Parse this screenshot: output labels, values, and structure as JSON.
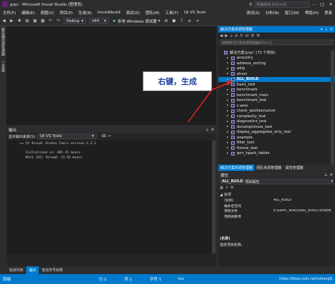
{
  "window": {
    "title": "grpc - Microsoft Visual Studio (管理员)",
    "quick_launch_placeholder": "快速启动 (Ctrl+Q)"
  },
  "menu": [
    "文件(F)",
    "编辑(E)",
    "视图(V)",
    "项目(P)",
    "生成(B)",
    "Incredibuild",
    "调试(D)",
    "团队(M)",
    "工具(T)",
    "Qt VS Tools",
    "测试(S)",
    "分析(N)",
    "窗口(W)",
    "帮助(H)"
  ],
  "account": "登录",
  "toolbar": {
    "config": "Debug",
    "platform": "x64",
    "run_label": "本地 Windows 调试器"
  },
  "left_tabs": [
    "服务器资源管理器",
    "工具箱"
  ],
  "output": {
    "title": "输出",
    "source_label": "显示输出来源(S):",
    "source_value": "Qt VS Tools",
    "lines": [
      "== Qt Visual Studio Tools version 2.3.2",
      "",
      "   Initialized in: 405.15 msecs",
      "   Main (UI) thread: 21.56 msecs"
    ]
  },
  "bottom_tabs": [
    {
      "label": "错误列表",
      "active": false
    },
    {
      "label": "输出",
      "active": true
    },
    {
      "label": "查找符号结果",
      "active": false
    }
  ],
  "status": {
    "ready": "就绪",
    "line": "行 1",
    "col": "列 1",
    "ch": "字符 1",
    "ins": "Ins",
    "watermark": "https://blog.csdn.net/yzhang9"
  },
  "solution": {
    "title": "解决方案资源管理器",
    "search_placeholder": "搜索解决方案资源管理器(Ctrl+;)",
    "root": "解决方案'grpc' (72 个项目)",
    "items": [
      "acountry",
      "address_sorting",
      "adig",
      "ahost",
      "ALL_BUILD",
      "basic_test",
      "benchmark",
      "benchmark_main",
      "benchmark_test",
      "c-ares",
      "check_epollexclusive",
      "complexity_test",
      "diagnostics_test",
      "donotoptimize_test",
      "display_aggregates_only_test",
      "example",
      "filter_test",
      "fixture_test",
      "gen_hpack_tables"
    ],
    "selected_index": 4,
    "tabs": [
      "解决方案资源管理器",
      "团队资源管理器",
      "属性管理器"
    ]
  },
  "properties": {
    "title": "属性",
    "object": "ALL_BUILD",
    "object_type": "项目属性",
    "category": "杂项",
    "rows": [
      {
        "name": "(名称)",
        "value": "ALL_BUILD"
      },
      {
        "name": "根命名空间",
        "value": ""
      },
      {
        "name": "项目文件",
        "value": "E:\\GRPC_BUILD\\ALL_BUILD.vcxproj"
      },
      {
        "name": "项目依赖项",
        "value": ""
      }
    ],
    "desc_title": "(名称)",
    "desc_text": "指定项目名称。"
  },
  "callout": {
    "text": "右键，生成"
  },
  "colors": {
    "accent": "#007acc",
    "callout_text": "#1f3f9f",
    "arrow": "#e02020"
  }
}
